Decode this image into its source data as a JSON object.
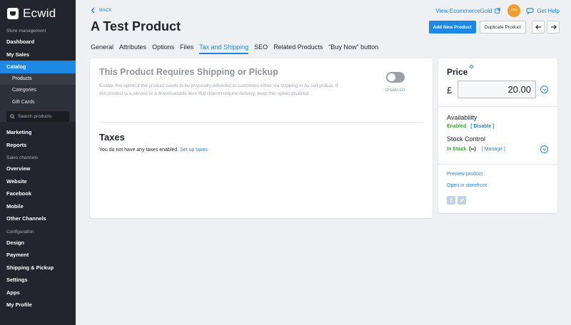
{
  "sidebar": {
    "logo": "Ecwid",
    "sections": {
      "store_management": "Store management",
      "sales_channels": "Sales channels",
      "configuration": "Configuration"
    },
    "items": {
      "dashboard": "Dashboard",
      "my_sales": "My Sales",
      "catalog": "Catalog",
      "products": "Products",
      "categories": "Categories",
      "gift_cards": "Gift Cards",
      "search_placeholder": "Search products",
      "marketing": "Marketing",
      "reports": "Reports",
      "overview": "Overview",
      "website": "Website",
      "facebook": "Facebook",
      "mobile": "Mobile",
      "other_channels": "Other Channels",
      "design": "Design",
      "payment": "Payment",
      "shipping_pickup": "Shipping & Pickup",
      "settings": "Settings",
      "apps": "Apps",
      "my_profile": "My Profile"
    }
  },
  "header": {
    "back": "BACK",
    "title": "A Test Product",
    "store_link": "View EcommerceGold",
    "avatar_initials": "PH",
    "help": "Get Help",
    "add_new": "Add New Product",
    "duplicate": "Duplicate Product"
  },
  "tabs": [
    "General",
    "Attributes",
    "Options",
    "Files",
    "Tax and Shipping",
    "SEO",
    "Related Products",
    "\"Buy Now\" button"
  ],
  "active_tab": "Tax and Shipping",
  "shipping": {
    "title": "This Product Requires Shipping or Pickup",
    "description": "Enable this option if the product needs to be physically delivered to customers either via shipping or by self-pickup. If this product is a service or a downloadable item that doesn't require delivery, keep this option disabled.",
    "toggle_state": "DISABLED"
  },
  "taxes": {
    "title": "Taxes",
    "text": "You do not have any taxes enabled.",
    "link": "Set up taxes"
  },
  "price_panel": {
    "title": "Price",
    "currency": "£",
    "value": "20.00",
    "availability_label": "Availability",
    "availability_status": "Enabled",
    "availability_action": "[ Disable ]",
    "stock_label": "Stock Control",
    "stock_status": "In Stock",
    "stock_symbol": "(∞)",
    "stock_action": "[ Manage ]",
    "preview": "Preview product",
    "storefront": "Open in storefront"
  },
  "colors": {
    "accent": "#1e88e5",
    "sidebar": "#22252c",
    "success": "#3aa335"
  }
}
